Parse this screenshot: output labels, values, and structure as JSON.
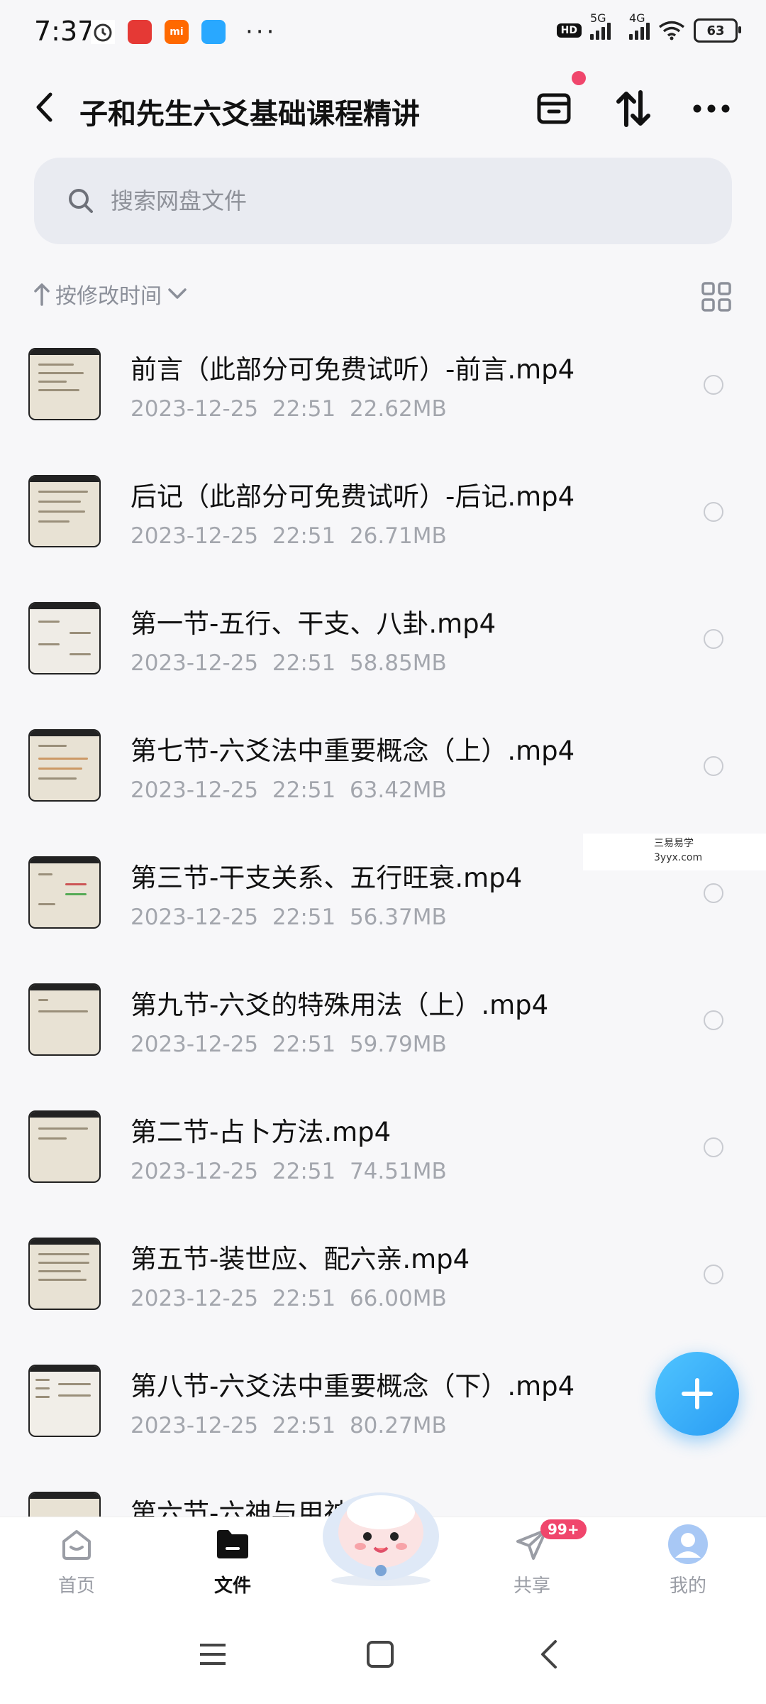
{
  "status_bar": {
    "time": "7:37",
    "network_1": "5G",
    "network_2": "4G",
    "hd": "HD",
    "battery": "63"
  },
  "header": {
    "title": "子和先生六爻基础课程精讲"
  },
  "search": {
    "placeholder": "搜索网盘文件"
  },
  "sort": {
    "label": "按修改时间"
  },
  "files": [
    {
      "name": "前言（此部分可免费试听）-前言.mp4",
      "date": "2023-12-25",
      "time": "22:51",
      "size": "22.62MB"
    },
    {
      "name": "后记（此部分可免费试听）-后记.mp4",
      "date": "2023-12-25",
      "time": "22:51",
      "size": "26.71MB"
    },
    {
      "name": "第一节-五行、干支、八卦.mp4",
      "date": "2023-12-25",
      "time": "22:51",
      "size": "58.85MB"
    },
    {
      "name": "第七节-六爻法中重要概念（上）.mp4",
      "date": "2023-12-25",
      "time": "22:51",
      "size": "63.42MB"
    },
    {
      "name": "第三节-干支关系、五行旺衰.mp4",
      "date": "2023-12-25",
      "time": "22:51",
      "size": "56.37MB"
    },
    {
      "name": "第九节-六爻的特殊用法（上）.mp4",
      "date": "2023-12-25",
      "time": "22:51",
      "size": "59.79MB"
    },
    {
      "name": "第二节-占卜方法.mp4",
      "date": "2023-12-25",
      "time": "22:51",
      "size": "74.51MB"
    },
    {
      "name": "第五节-装世应、配六亲.mp4",
      "date": "2023-12-25",
      "time": "22:51",
      "size": "66.00MB"
    },
    {
      "name": "第八节-六爻法中重要概念（下）.mp4",
      "date": "2023-12-25",
      "time": "22:51",
      "size": "80.27MB"
    },
    {
      "name": "第六节-六神与用神",
      "date": "",
      "time": "",
      "size": ""
    }
  ],
  "watermark": {
    "line1": "三易易学",
    "line2": "3yyx.com"
  },
  "bottom_nav": {
    "home": "首页",
    "files": "文件",
    "share": "共享",
    "share_badge": "99+",
    "me": "我的"
  },
  "colors": {
    "accent": "#2a9df4",
    "badge_red": "#f0466c",
    "meta_gray": "#a3a6ad",
    "search_bg": "#e9ebf1"
  }
}
